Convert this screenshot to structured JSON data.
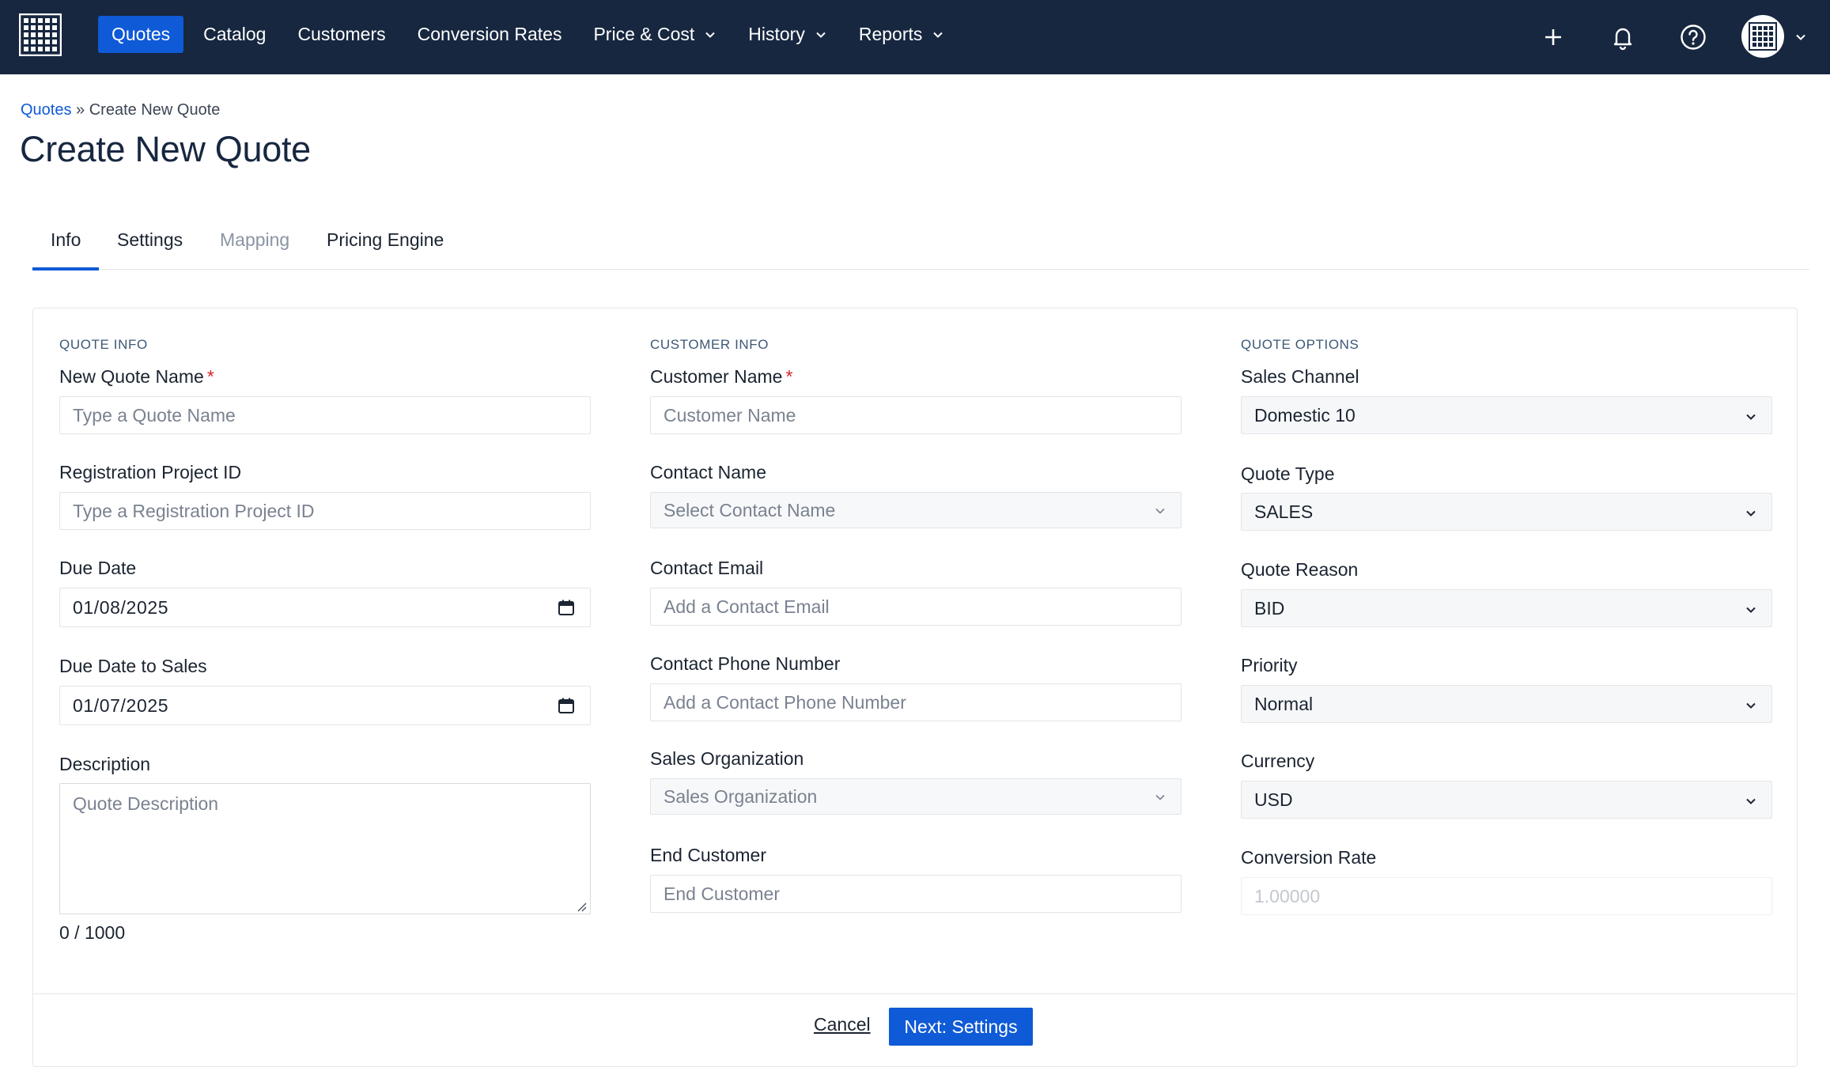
{
  "nav": {
    "items": [
      {
        "label": "Quotes"
      },
      {
        "label": "Catalog"
      },
      {
        "label": "Customers"
      },
      {
        "label": "Conversion Rates"
      },
      {
        "label": "Price & Cost"
      },
      {
        "label": "History"
      },
      {
        "label": "Reports"
      }
    ],
    "active": "Quotes"
  },
  "breadcrumb": {
    "root": "Quotes",
    "separator": "»",
    "current": "Create New Quote"
  },
  "page_title": "Create New Quote",
  "tabs": [
    {
      "label": "Info",
      "state": "active"
    },
    {
      "label": "Settings",
      "state": "enabled"
    },
    {
      "label": "Mapping",
      "state": "disabled"
    },
    {
      "label": "Pricing Engine",
      "state": "enabled"
    }
  ],
  "quote_info": {
    "section_label": "QUOTE INFO",
    "quote_name": {
      "label": "New Quote Name",
      "required_mark": "*",
      "value": "",
      "placeholder": "Type a Quote Name"
    },
    "registration_project_id": {
      "label": "Registration Project ID",
      "value": "",
      "placeholder": "Type a Registration Project ID"
    },
    "due_date": {
      "label": "Due Date",
      "value": "01/08/2025"
    },
    "due_date_to_sales": {
      "label": "Due Date to Sales",
      "value": "01/07/2025"
    },
    "description": {
      "label": "Description",
      "value": "",
      "placeholder": "Quote Description",
      "counter": "0 / 1000"
    }
  },
  "customer_info": {
    "section_label": "CUSTOMER INFO",
    "customer_name": {
      "label": "Customer Name",
      "required_mark": "*",
      "value": "",
      "placeholder": "Customer Name"
    },
    "contact_name": {
      "label": "Contact Name",
      "placeholder": "Select Contact Name"
    },
    "contact_email": {
      "label": "Contact Email",
      "value": "",
      "placeholder": "Add a Contact Email"
    },
    "contact_phone": {
      "label": "Contact Phone Number",
      "value": "",
      "placeholder": "Add a Contact Phone Number"
    },
    "sales_organization": {
      "label": "Sales Organization",
      "placeholder": "Sales Organization"
    },
    "end_customer": {
      "label": "End Customer",
      "value": "",
      "placeholder": "End Customer"
    }
  },
  "quote_options": {
    "section_label": "QUOTE OPTIONS",
    "sales_channel": {
      "label": "Sales Channel",
      "selected": "Domestic 10"
    },
    "quote_type": {
      "label": "Quote Type",
      "selected": "SALES"
    },
    "quote_reason": {
      "label": "Quote Reason",
      "selected": "BID"
    },
    "priority": {
      "label": "Priority",
      "selected": "Normal"
    },
    "currency": {
      "label": "Currency",
      "selected": "USD"
    },
    "conversion_rate": {
      "label": "Conversion Rate",
      "value": "1.00000"
    }
  },
  "footer": {
    "cancel_label": "Cancel",
    "next_label": "Next: Settings"
  },
  "icons": {
    "logo": "grid-logo-icon",
    "add": "plus-icon",
    "notifications": "bell-icon",
    "help": "help-circle-icon",
    "avatar": "grid-avatar-icon",
    "dropdown": "chevron-down-icon",
    "calendar": "calendar-icon"
  },
  "colors": {
    "nav_background": "#172740",
    "accent": "#0f5ad6",
    "required": "#d4262a",
    "section_label": "#3d5878"
  }
}
